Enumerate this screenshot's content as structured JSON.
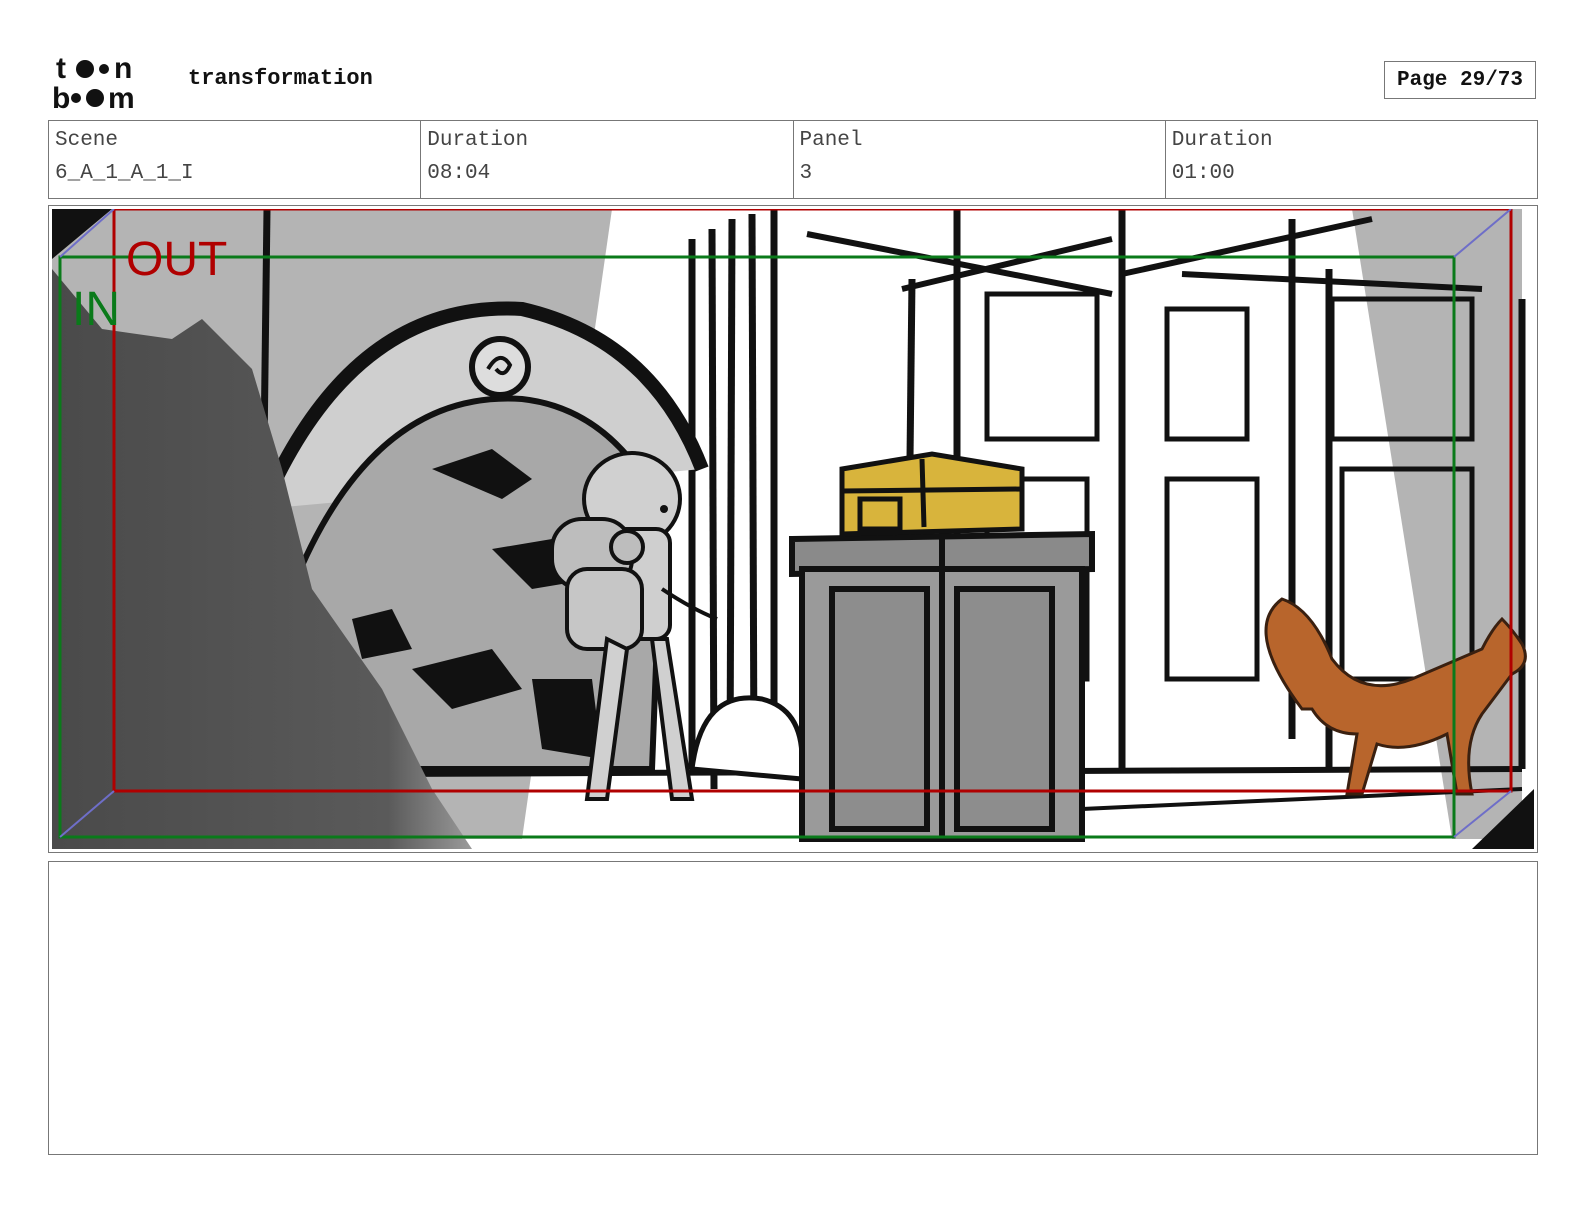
{
  "header": {
    "logo_text": "toon boom",
    "project_title": "transformation",
    "page_label": "Page 29/73"
  },
  "info": [
    {
      "label": "Scene",
      "value": "6_A_1_A_1_I"
    },
    {
      "label": "Duration",
      "value": "08:04"
    },
    {
      "label": "Panel",
      "value": "3"
    },
    {
      "label": "Duration",
      "value": "01:00"
    }
  ],
  "panel": {
    "camera_in_label": "IN",
    "camera_out_label": "OUT",
    "camera_in_color": "#0a7a1a",
    "camera_out_color": "#b00000",
    "chest_color": "#d8b43c",
    "fox_color": "#b8652c"
  },
  "notes": {
    "text": ""
  }
}
